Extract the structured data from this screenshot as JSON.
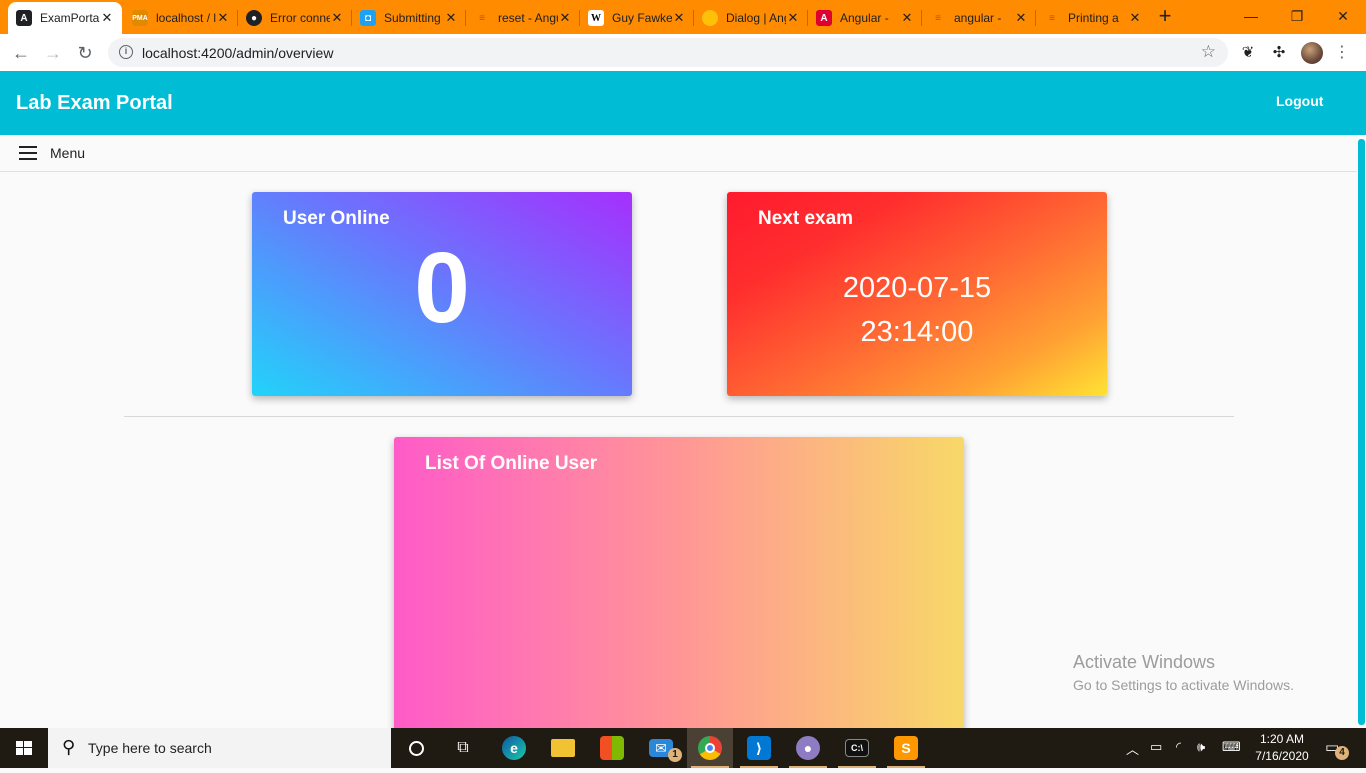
{
  "browser": {
    "tabs": [
      {
        "title": "ExamPortal",
        "active": true,
        "icon": "angular-icon"
      },
      {
        "title": "localhost / localhost",
        "icon": "phpmyadmin-icon"
      },
      {
        "title": "Error connecting",
        "icon": "github-icon"
      },
      {
        "title": "Submitting",
        "icon": "discord-icon"
      },
      {
        "title": "reset - Angular",
        "icon": "stackoverflow-icon"
      },
      {
        "title": "Guy Fawkes",
        "icon": "wikipedia-icon"
      },
      {
        "title": "Dialog | Angular",
        "icon": "material-icon"
      },
      {
        "title": "Angular - ",
        "icon": "angular-red-icon"
      },
      {
        "title": "angular - ",
        "icon": "stackoverflow-icon"
      },
      {
        "title": "Printing a",
        "icon": "stackoverflow-icon"
      }
    ],
    "close_glyph": "✕",
    "new_tab_glyph": "+",
    "url": "localhost:4200/admin/overview"
  },
  "app": {
    "title": "Lab Exam Portal",
    "logout_label": "Logout",
    "menu_label": "Menu",
    "user_online": {
      "title": "User Online",
      "count": "0"
    },
    "next_exam": {
      "title": "Next exam",
      "date": "2020-07-15",
      "time": "23:14:00"
    },
    "online_users": {
      "title": "List Of Online User",
      "users": []
    }
  },
  "watermark": {
    "line1": "Activate Windows",
    "line2": "Go to Settings to activate Windows."
  },
  "taskbar": {
    "search_placeholder": "Type here to search",
    "mail_badge": "1",
    "time": "1:20 AM",
    "date": "7/16/2020",
    "notification_count": "4"
  },
  "colors": {
    "appbar": "#00bcd4",
    "tabstrip": "#ff8c00",
    "taskbar": "#1f1a12"
  }
}
